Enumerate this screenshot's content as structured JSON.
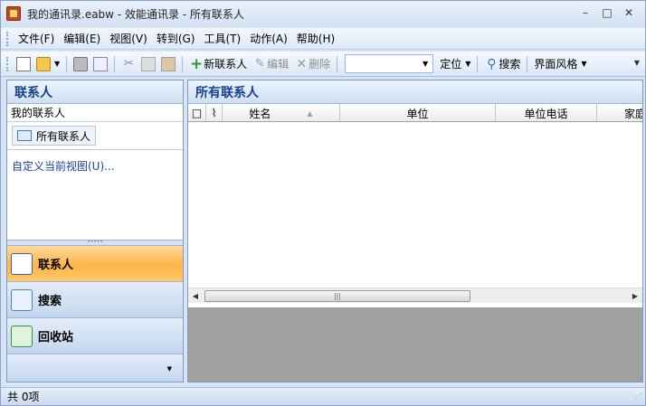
{
  "window": {
    "title": "我的通讯录.eabw - 效能通讯录 - 所有联系人",
    "buttons": [
      "–",
      "□",
      "✕"
    ]
  },
  "menu": [
    "文件(F)",
    "编辑(E)",
    "视图(V)",
    "转到(G)",
    "工具(T)",
    "动作(A)",
    "帮助(H)"
  ],
  "toolbar": {
    "new_contact": "新联系人",
    "edit": "编辑",
    "delete": "删除",
    "locate": "定位",
    "search": "搜索",
    "style": "界面风格",
    "combo_value": ""
  },
  "left_panel": {
    "header": "联系人",
    "subheader": "我的联系人",
    "selected_item": "所有联系人",
    "customize_link": "自定义当前视图(U)...",
    "nav": [
      {
        "label": "联系人",
        "active": true,
        "icon": "contact-card-icon"
      },
      {
        "label": "搜索",
        "active": false,
        "icon": "magnifier-icon"
      },
      {
        "label": "回收站",
        "active": false,
        "icon": "recycle-icon"
      }
    ]
  },
  "right_panel": {
    "header": "所有联系人",
    "columns": [
      "姓名",
      "单位",
      "单位电话",
      "家庭"
    ],
    "rows": []
  },
  "status": {
    "text": "共 0项"
  }
}
